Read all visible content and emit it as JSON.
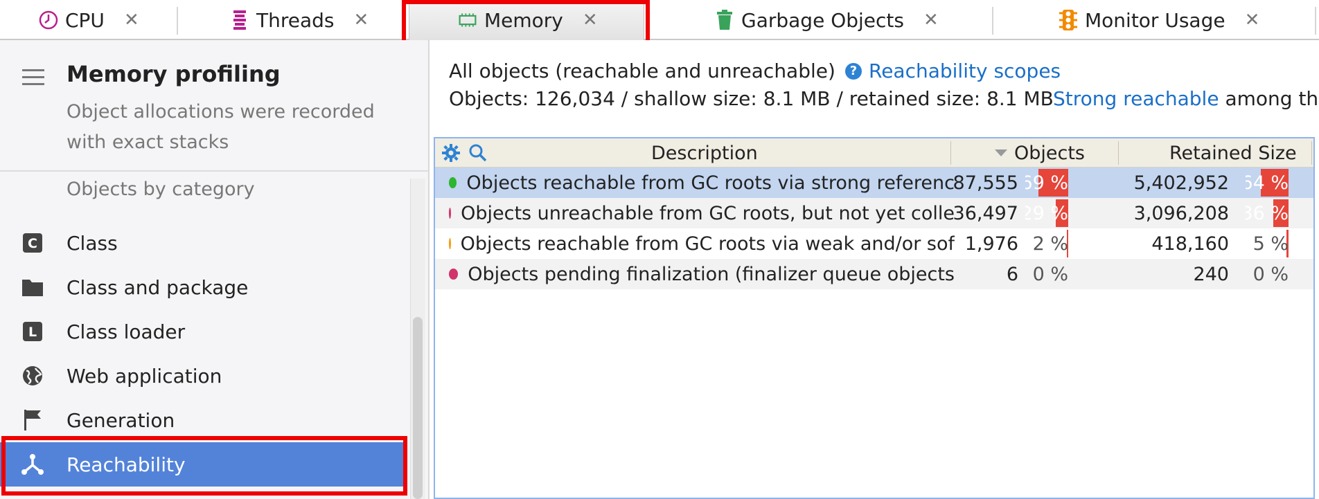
{
  "tabs": [
    {
      "label": "CPU",
      "icon": "clock-icon"
    },
    {
      "label": "Threads",
      "icon": "threads-icon"
    },
    {
      "label": "Memory",
      "icon": "memory-chip-icon"
    },
    {
      "label": "Garbage Objects",
      "icon": "trash-icon"
    },
    {
      "label": "Monitor Usage",
      "icon": "traffic-light-icon"
    }
  ],
  "active_tab": "Memory",
  "close_glyph": "✕",
  "sidebar": {
    "title": "Memory profiling",
    "subtitle": "Object allocations were recorded with exact stacks",
    "category_header": "Objects by category",
    "items": [
      {
        "label": "Class",
        "icon": "class-icon"
      },
      {
        "label": "Class and package",
        "icon": "folder-icon"
      },
      {
        "label": "Class loader",
        "icon": "class-loader-icon"
      },
      {
        "label": "Web application",
        "icon": "globe-icon"
      },
      {
        "label": "Generation",
        "icon": "flag-icon"
      },
      {
        "label": "Reachability",
        "icon": "reachability-icon"
      }
    ],
    "selected": "Reachability"
  },
  "info": {
    "scope_title": "All objects (reachable and unreachable)",
    "scopes_link": "Reachability scopes",
    "summary": "Objects: 126,034 / shallow size: 8.1 MB / retained size: 8.1 MB",
    "strong_link": "Strong reachable",
    "strong_rest": "among th"
  },
  "table": {
    "columns": {
      "description": "Description",
      "objects": "Objects",
      "retained": "Retained Size"
    },
    "rows": [
      {
        "description": "Objects reachable from GC roots via strong referenc",
        "dot_color": "#2fb52f",
        "objects": "87,555",
        "objects_pct": "69 %",
        "objects_frac": 0.69,
        "retained": "5,402,952",
        "retained_pct": "64 %",
        "retained_frac": 0.64
      },
      {
        "description": "Objects unreachable from GC roots, but not yet colle",
        "dot_color": "#d0346a",
        "objects": "36,497",
        "objects_pct": "29 %",
        "objects_frac": 0.29,
        "retained": "3,096,208",
        "retained_pct": "36 %",
        "retained_frac": 0.36
      },
      {
        "description": "Objects reachable from GC roots via weak and/or sof",
        "dot_color": "#f39c12",
        "objects": "1,976",
        "objects_pct": "2 %",
        "objects_frac": 0.02,
        "retained": "418,160",
        "retained_pct": "5 %",
        "retained_frac": 0.05
      },
      {
        "description": "Objects pending finalization (finalizer queue objects",
        "dot_color": "#d0346a",
        "objects": "6",
        "objects_pct": "0 %",
        "objects_frac": 0.0,
        "retained": "240",
        "retained_pct": "0 %",
        "retained_frac": 0.0
      }
    ]
  }
}
